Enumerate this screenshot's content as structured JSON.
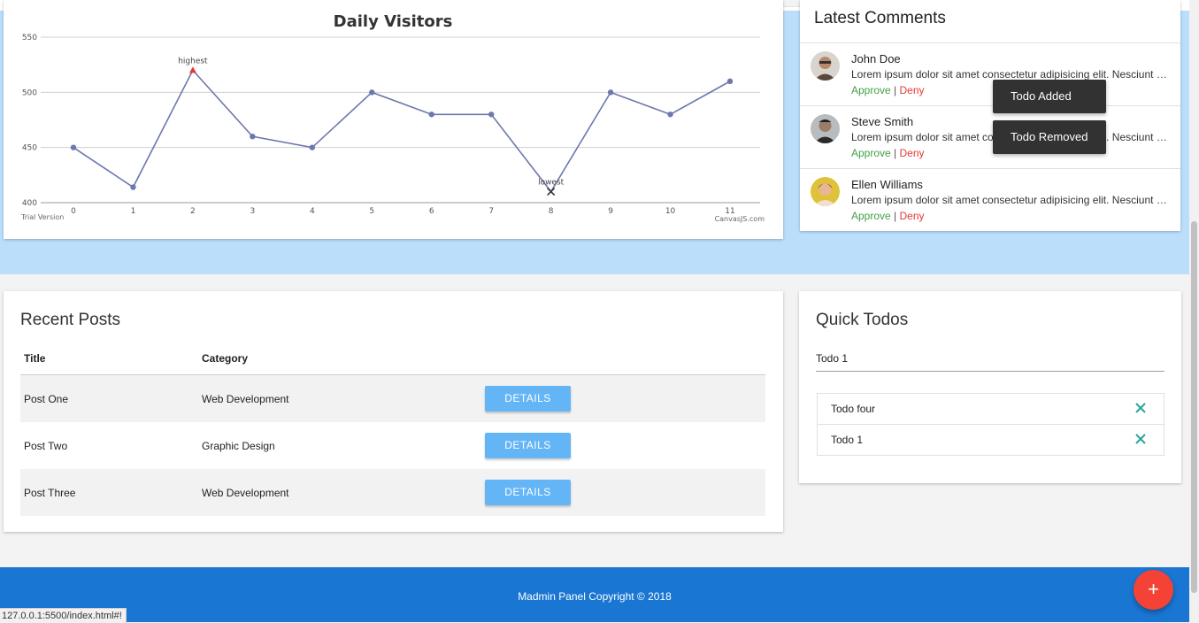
{
  "status_url": "127.0.0.1:5500/index.html#!",
  "chart_data": {
    "type": "line",
    "title": "Daily Visitors",
    "x": [
      0,
      1,
      2,
      3,
      4,
      5,
      6,
      7,
      8,
      9,
      10,
      11
    ],
    "values": [
      450,
      414,
      520,
      460,
      450,
      500,
      480,
      480,
      410,
      500,
      480,
      510
    ],
    "ylim": [
      400,
      550
    ],
    "yticks": [
      400,
      450,
      500,
      550
    ],
    "grid": true,
    "annotations": [
      {
        "index": 2,
        "label": "highest"
      },
      {
        "index": 8,
        "label": "lowest"
      }
    ],
    "watermark_left": "Trial Version",
    "watermark_right": "CanvasJS.com",
    "line_color": "#6d78ad"
  },
  "comments": {
    "title": "Latest Comments",
    "approve_label": "Approve",
    "separator": "|",
    "deny_label": "Deny",
    "items": [
      {
        "name": "John Doe",
        "text": "Lorem ipsum dolor sit amet consectetur adipisicing elit. Nesciunt dolorum"
      },
      {
        "name": "Steve Smith",
        "text": "Lorem ipsum dolor sit amet consectetur adipisicing elit. Nesciunt dolorum"
      },
      {
        "name": "Ellen Williams",
        "text": "Lorem ipsum dolor sit amet consectetur adipisicing elit. Nesciunt dolorum"
      }
    ]
  },
  "toasts": [
    "Todo Added",
    "Todo Removed"
  ],
  "posts": {
    "title": "Recent Posts",
    "headers": [
      "Title",
      "Category"
    ],
    "button_label": "DETAILS",
    "rows": [
      {
        "title": "Post One",
        "category": "Web Development"
      },
      {
        "title": "Post Two",
        "category": "Graphic Design"
      },
      {
        "title": "Post Three",
        "category": "Web Development"
      }
    ]
  },
  "todos": {
    "title": "Quick Todos",
    "input_value": "Todo 1",
    "items": [
      "Todo four",
      "Todo 1"
    ],
    "accent": "#26a69a"
  },
  "footer": {
    "text": "Madmin Panel Copyright © 2018"
  },
  "fab": {
    "label": "+",
    "color": "#f44336"
  },
  "colors": {
    "band": "#bbdefb",
    "footer": "#1976d2",
    "details_button": "#64b5f6"
  }
}
